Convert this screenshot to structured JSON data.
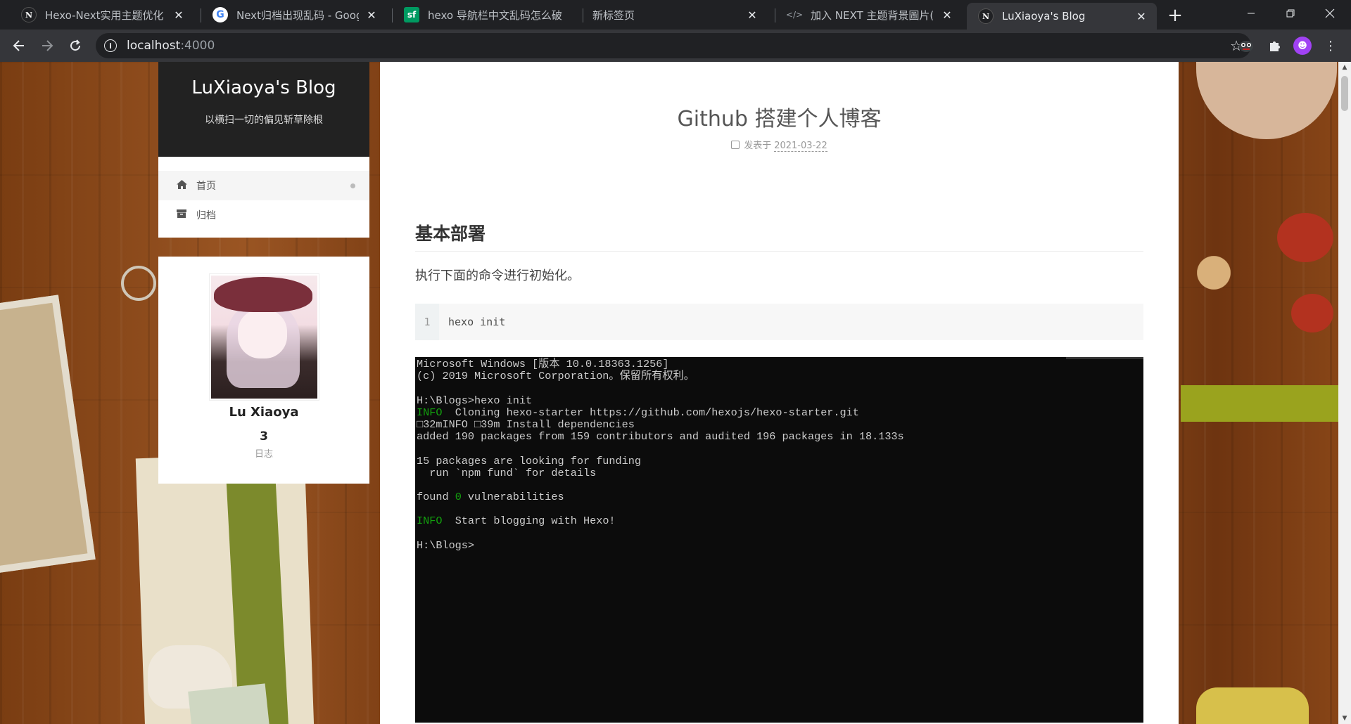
{
  "browser": {
    "tabs": [
      {
        "title": "Hexo-Next实用主题优化 | H",
        "favicon": "N"
      },
      {
        "title": "Next归档出现乱码 - Google",
        "favicon": "G"
      },
      {
        "title": "hexo 导航栏中文乱码怎么破",
        "favicon": "sf"
      },
      {
        "title": "新标签页",
        "favicon": ""
      },
      {
        "title": "加入 NEXT 主题背景圖片(NE",
        "favicon": "</>"
      },
      {
        "title": "LuXiaoya's Blog",
        "favicon": "N"
      }
    ],
    "new_tab": "+",
    "close_glyph": "✕",
    "url_host": "localhost",
    "url_port": ":4000",
    "accent_color": "#a142f4"
  },
  "site": {
    "title": "LuXiaoya's Blog",
    "subtitle": "以横扫一切的偏见斩草除根",
    "menu": [
      {
        "label": "首页",
        "icon": "home-icon"
      },
      {
        "label": "归档",
        "icon": "archive-icon"
      }
    ]
  },
  "author": {
    "name": "Lu Xiaoya",
    "posts_count": "3",
    "posts_label": "日志"
  },
  "post": {
    "title": "Github 搭建个人博客",
    "meta_label": "发表于",
    "date": "2021-03-22",
    "heading": "基本部署",
    "paragraph": "执行下面的命令进行初始化。",
    "code_line_no": "1",
    "code": "hexo init"
  },
  "terminal": {
    "lines": [
      {
        "text": "Microsoft Windows [版本 10.0.18363.1256]"
      },
      {
        "text": "(c) 2019 Microsoft Corporation。保留所有权利。"
      },
      {
        "text": ""
      },
      {
        "text": "H:\\Blogs>hexo init"
      },
      {
        "prefix": "INFO",
        "text": "  Cloning hexo-starter https://github.com/hexojs/hexo-starter.git"
      },
      {
        "text": "□32mINFO □39m Install dependencies"
      },
      {
        "text": "added 190 packages from 159 contributors and audited 196 packages in 18.133s"
      },
      {
        "text": ""
      },
      {
        "text": "15 packages are looking for funding"
      },
      {
        "text": "  run `npm fund` for details"
      },
      {
        "text": ""
      },
      {
        "text": "found ",
        "green": "0",
        "after": " vulnerabilities"
      },
      {
        "text": ""
      },
      {
        "prefix": "INFO",
        "text": "  Start blogging with Hexo!"
      },
      {
        "text": ""
      },
      {
        "text": "H:\\Blogs>"
      }
    ]
  }
}
